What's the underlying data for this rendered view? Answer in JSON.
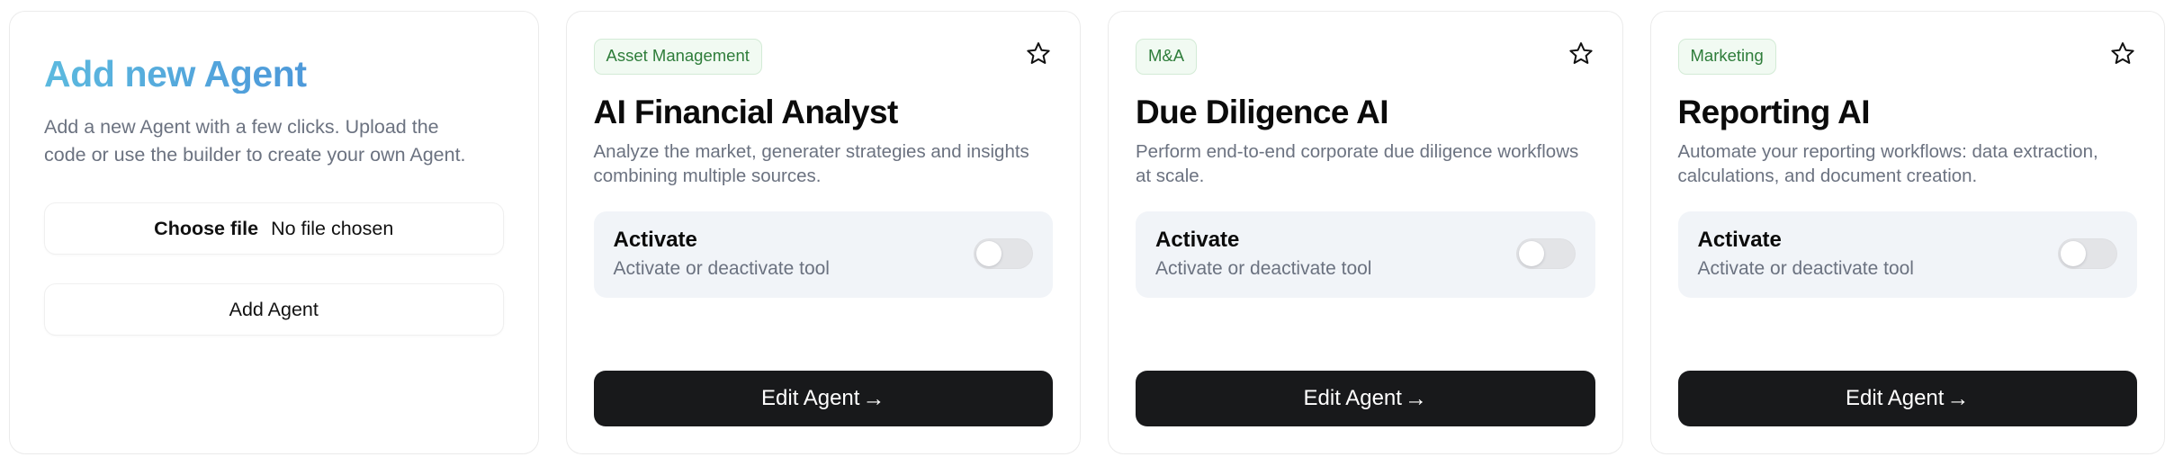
{
  "colors": {
    "badge_text": "#2e7d3a",
    "badge_bg": "#f1faf2",
    "badge_border": "#d3ebd6",
    "title_gradient_start": "#5cbadf",
    "title_gradient_end": "#4a8fd6",
    "card_border": "#ebebeb",
    "panel_bg": "#f1f4f8",
    "button_dark": "#18191b",
    "muted_text": "#6b7280",
    "toggle_track": "#e3e4e7"
  },
  "add_card": {
    "title": "Add new Agent",
    "description": "Add a new Agent with a few clicks. Upload the code or use the builder to create your own Agent.",
    "file_input": {
      "button_label": "Choose file",
      "status": "No file chosen"
    },
    "submit_label": "Add Agent"
  },
  "shared": {
    "activate_title": "Activate",
    "activate_subtitle": "Activate or deactivate tool",
    "edit_label": "Edit Agent",
    "edit_arrow": "→",
    "star_icon": "star-outline-icon"
  },
  "agents": [
    {
      "badge": "Asset Management",
      "title": "AI Financial Analyst",
      "description": "Analyze the market, generater strategies and insights combining multiple sources.",
      "activate_title": "Activate",
      "activate_subtitle": "Activate or deactivate tool",
      "toggle_state": "off",
      "edit_label": "Edit Agent",
      "favorited": false
    },
    {
      "badge": "M&A",
      "title": "Due Diligence AI",
      "description": "Perform end-to-end corporate due diligence workflows at scale.",
      "activate_title": "Activate",
      "activate_subtitle": "Activate or deactivate tool",
      "toggle_state": "off",
      "edit_label": "Edit Agent",
      "favorited": false
    },
    {
      "badge": "Marketing",
      "title": "Reporting AI",
      "description": "Automate your reporting workflows: data extraction, calculations, and document creation.",
      "activate_title": "Activate",
      "activate_subtitle": "Activate or deactivate tool",
      "toggle_state": "off",
      "edit_label": "Edit Agent",
      "favorited": false
    }
  ]
}
